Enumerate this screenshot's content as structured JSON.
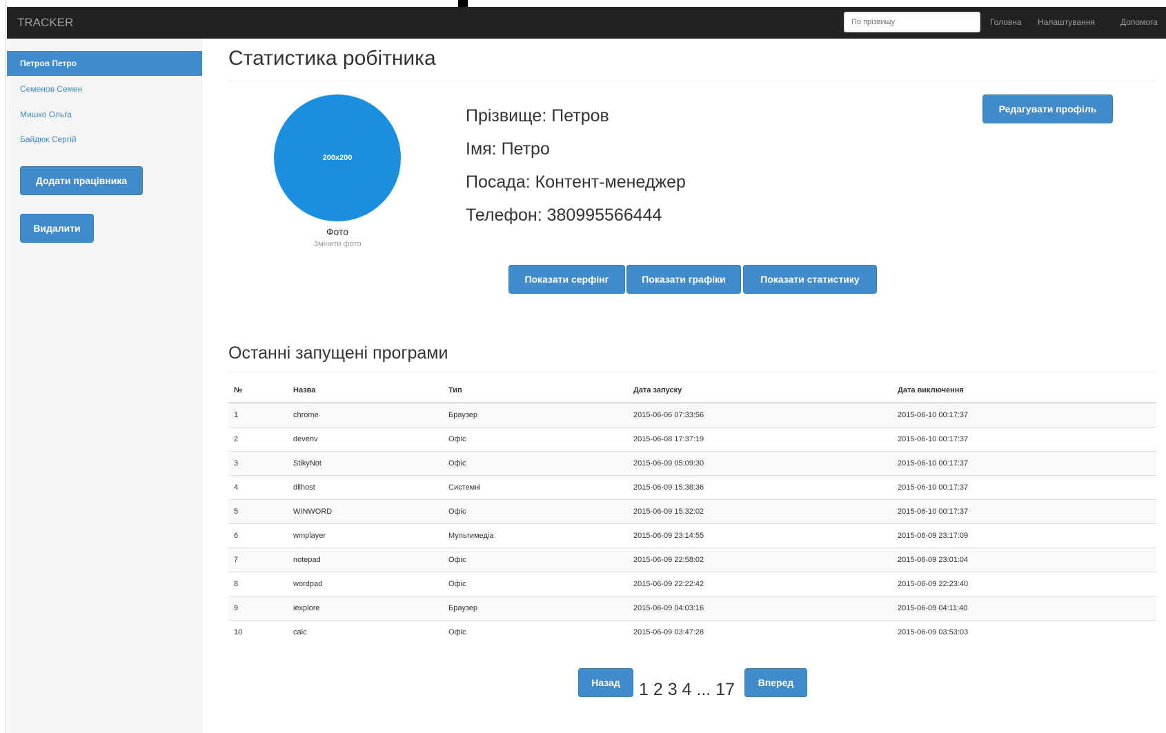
{
  "brand": "TRACKER",
  "search": {
    "placeholder": "По прізвищу"
  },
  "nav": {
    "home": "Головна",
    "settings": "Налаштування",
    "help": "Допомога"
  },
  "sidebar": {
    "items": [
      {
        "label": "Петров Петро",
        "active": true
      },
      {
        "label": "Семенов Семен",
        "active": false
      },
      {
        "label": "Мишко Ольга",
        "active": false
      },
      {
        "label": "Байдюк Сергій",
        "active": false
      }
    ],
    "add_button": "Додати працівника",
    "delete_button": "Видалити"
  },
  "page": {
    "title": "Статистика робітника",
    "edit_profile_button": "Редагувати профіль",
    "photo": {
      "placeholder": "200x200",
      "label": "Фото",
      "change_link": "Змінити фото"
    },
    "info": {
      "surname": "Прізвище: Петров",
      "name": "Імя: Петро",
      "position": "Посада: Контент-менеджер",
      "phone": "Телефон: 380995566444"
    },
    "actions": {
      "surfing": "Показати серфінг",
      "graphs": "Показати графіки",
      "stats": "Показати статистику"
    },
    "recent_title": "Останні запущені програми"
  },
  "table": {
    "headers": [
      "№",
      "Назва",
      "Тип",
      "Дата запуску",
      "Дата виключення"
    ],
    "rows": [
      [
        "1",
        "chrome",
        "Браузер",
        "2015-06-06 07:33:56",
        "2015-06-10 00:17:37"
      ],
      [
        "2",
        "devenv",
        "Офіс",
        "2015-06-08 17:37:19",
        "2015-06-10 00:17:37"
      ],
      [
        "3",
        "StikyNot",
        "Офіс",
        "2015-06-09 05:09:30",
        "2015-06-10 00:17:37"
      ],
      [
        "4",
        "dllhost",
        "Системні",
        "2015-06-09 15:38:36",
        "2015-06-10 00:17:37"
      ],
      [
        "5",
        "WINWORD",
        "Офіс",
        "2015-06-09 15:32:02",
        "2015-06-10 00:17:37"
      ],
      [
        "6",
        "wmplayer",
        "Мультимедіа",
        "2015-06-09 23:14:55",
        "2015-06-09 23:17:09"
      ],
      [
        "7",
        "notepad",
        "Офіс",
        "2015-06-09 22:58:02",
        "2015-06-09 23:01:04"
      ],
      [
        "8",
        "wordpad",
        "Офіс",
        "2015-06-09 22:22:42",
        "2015-06-09 22:23:40"
      ],
      [
        "9",
        "iexplore",
        "Браузер",
        "2015-06-09 04:03:16",
        "2015-06-09 04:11:40"
      ],
      [
        "10",
        "calc",
        "Офіс",
        "2015-06-09 03:47:28",
        "2015-06-09 03:53:03"
      ]
    ]
  },
  "pager": {
    "prev": "Назад",
    "pages": "1 2 3 4 ... 17",
    "next": "Вперед"
  },
  "colors": {
    "primary": "#428bca",
    "navbar": "#222222",
    "photo": "#1a8fe0"
  }
}
